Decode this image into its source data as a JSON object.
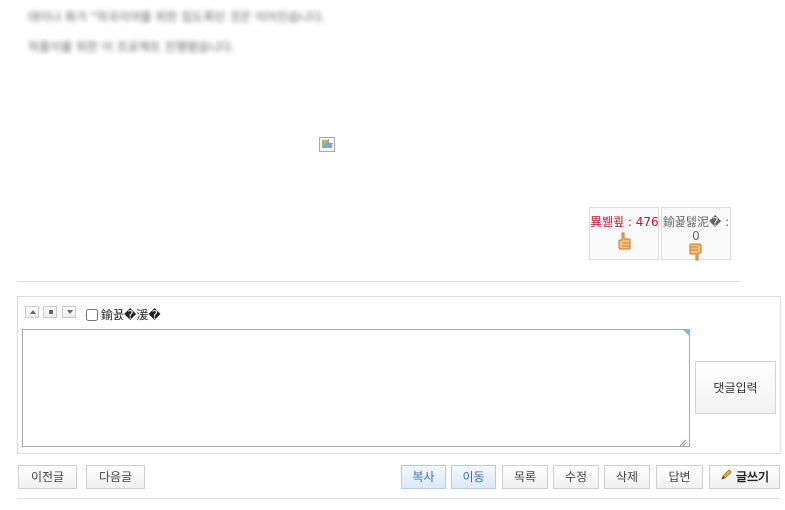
{
  "post": {
    "line1": "데이나 화가 \"작곡이야를 위한 집도록던 것은 이어진습니다.",
    "line2": "작품이를 위한 이 프로젝트 진행됐습니다."
  },
  "votes": {
    "up_label": "異붿쿂 : 476",
    "down_label": "鍮꾩텛泥� :",
    "down_count": "0"
  },
  "comment": {
    "secret_label": "鍮꾨�湲�",
    "textarea_value": "",
    "submit_label": "댓글입력"
  },
  "buttons": {
    "prev": "이전글",
    "next": "다음글",
    "copy": "복사",
    "move": "이동",
    "list": "목록",
    "edit": "수정",
    "delete": "삭제",
    "reply": "답변",
    "write": "글쓰기"
  },
  "colors": {
    "vote_up": "#c8102e",
    "accent_blue": "#3c6ea5",
    "thumb": "#e08a2c"
  },
  "icons": [
    "broken-image-icon",
    "thumbs-up-icon",
    "thumbs-down-icon",
    "arrow-up-icon",
    "square-icon",
    "arrow-down-icon",
    "resize-grip-icon",
    "pencil-icon"
  ]
}
